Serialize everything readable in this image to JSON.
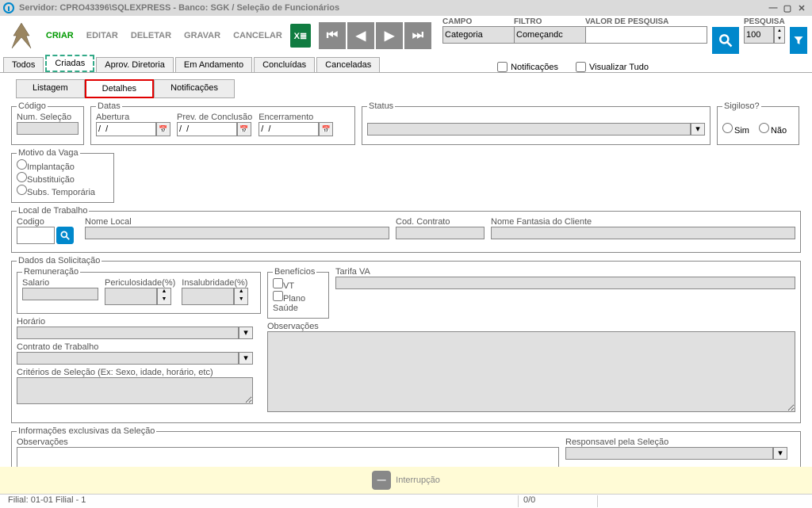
{
  "titlebar": "Servidor: CPRO43396\\SQLEXPRESS - Banco: SGK / Seleção de Funcionários",
  "toolbar": {
    "criar": "CRIAR",
    "editar": "EDITAR",
    "deletar": "DELETAR",
    "gravar": "GRAVAR",
    "cancelar": "CANCELAR"
  },
  "search": {
    "campo_lbl": "CAMPO",
    "campo_val": "Categoria",
    "filtro_lbl": "FILTRO",
    "filtro_val": "Começandc",
    "valor_lbl": "VALOR DE PESQUISA",
    "valor_val": "",
    "pesquisa_lbl": "PESQUISA",
    "pesquisa_val": "100"
  },
  "subtabs": [
    "Todos",
    "Criadas",
    "Aprov. Diretoria",
    "Em Andamento",
    "Concluídas",
    "Canceladas"
  ],
  "checks": {
    "notif": "Notificações",
    "vistudo": "Visualizar Tudo"
  },
  "inner_tabs": [
    "Listagem",
    "Detalhes",
    "Notificações"
  ],
  "codigo": {
    "legend": "Código",
    "num": "Num. Seleção"
  },
  "datas": {
    "legend": "Datas",
    "abertura": "Abertura",
    "prev": "Prev. de Conclusão",
    "enc": "Encerramento",
    "val": "/  /"
  },
  "status": {
    "legend": "Status"
  },
  "sigiloso": {
    "legend": "Sigiloso?",
    "sim": "Sim",
    "nao": "Não"
  },
  "motivo": {
    "legend": "Motivo da Vaga",
    "imp": "Implantação",
    "sub": "Substituição",
    "temp": "Subs. Temporária"
  },
  "local": {
    "legend": "Local de Trabalho",
    "cod": "Codigo",
    "nome": "Nome Local",
    "contrato": "Cod. Contrato",
    "fantasia": "Nome Fantasia do Cliente"
  },
  "dados": {
    "legend": "Dados da Solicitação",
    "rem_legend": "Remuneração",
    "salario": "Salario",
    "peric": "Periculosidade(%)",
    "insal": "Insalubridade(%)",
    "ben_legend": "Benefícios",
    "vt": "VT",
    "plano": "Plano Saúde",
    "tarifa": "Tarifa VA",
    "horario": "Horário",
    "contrato": "Contrato de Trabalho",
    "criterios": "Critérios de Seleção (Ex: Sexo, idade, horário, etc)",
    "obs": "Observações"
  },
  "info": {
    "legend": "Informações exclusivas da Seleção",
    "obs": "Observações",
    "resp": "Responsavel pela Seleção"
  },
  "interrupt": "Interrupção",
  "status_filial": "Filial: 01-01 Filial - 1",
  "status_count": "0/0"
}
